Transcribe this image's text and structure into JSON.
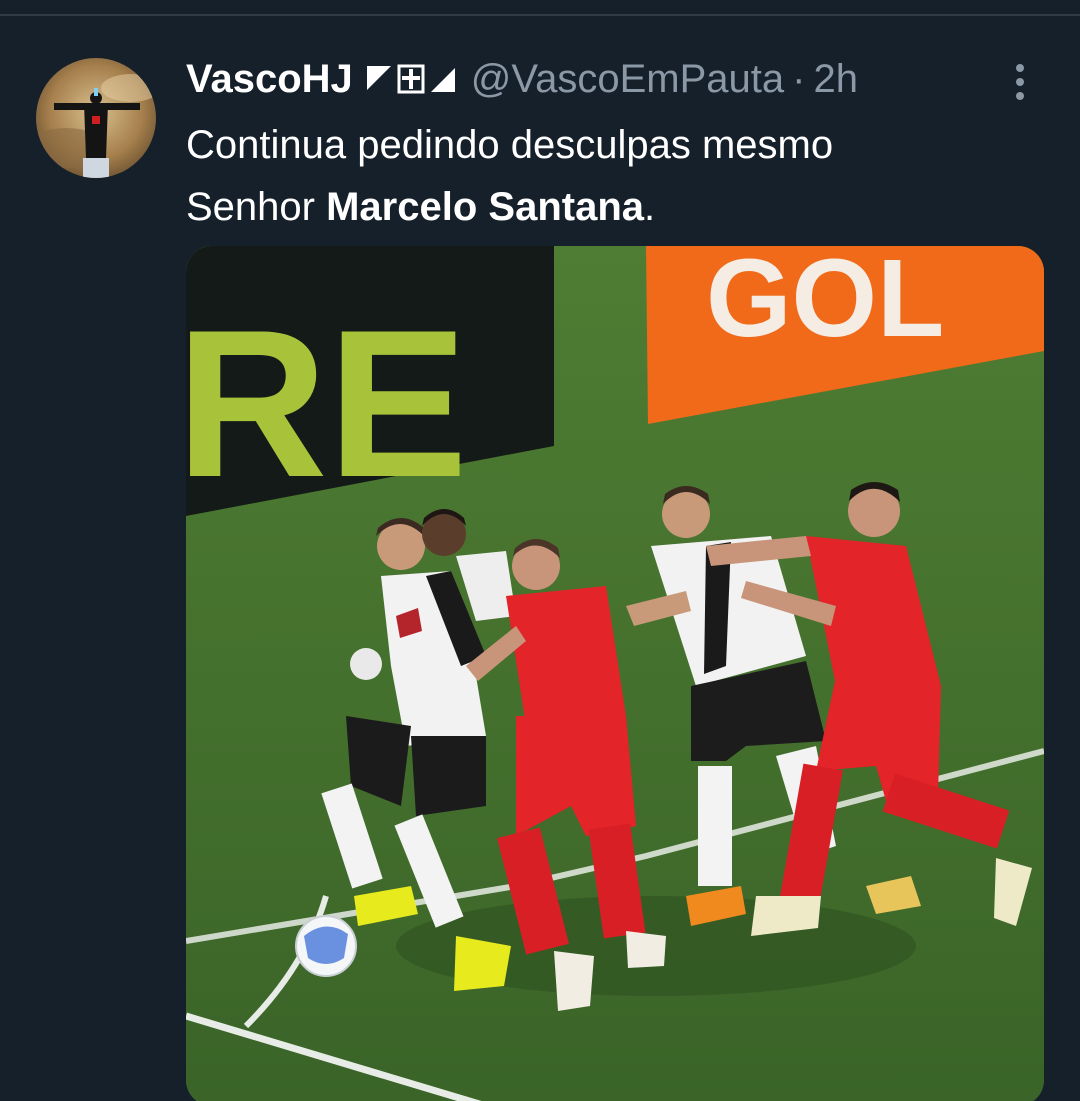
{
  "tweet": {
    "display_name": "VascoHJ",
    "handle": "@VascoEmPauta",
    "separator": "·",
    "time": "2h",
    "text_line1": "Continua pedindo desculpas mesmo",
    "text_line2_prefix": "Senhor ",
    "text_line2_bold": "Marcelo Santana",
    "text_line2_suffix": "."
  },
  "media": {
    "board_left_text": "RE",
    "board_right_text": "GOL"
  },
  "colors": {
    "background": "#15202b",
    "secondary_text": "#8b98a5",
    "pitch": "#41702d",
    "sponsor_orange": "#f06a19",
    "sponsor_green": "#a8c23a",
    "kit_red": "#e32429"
  }
}
